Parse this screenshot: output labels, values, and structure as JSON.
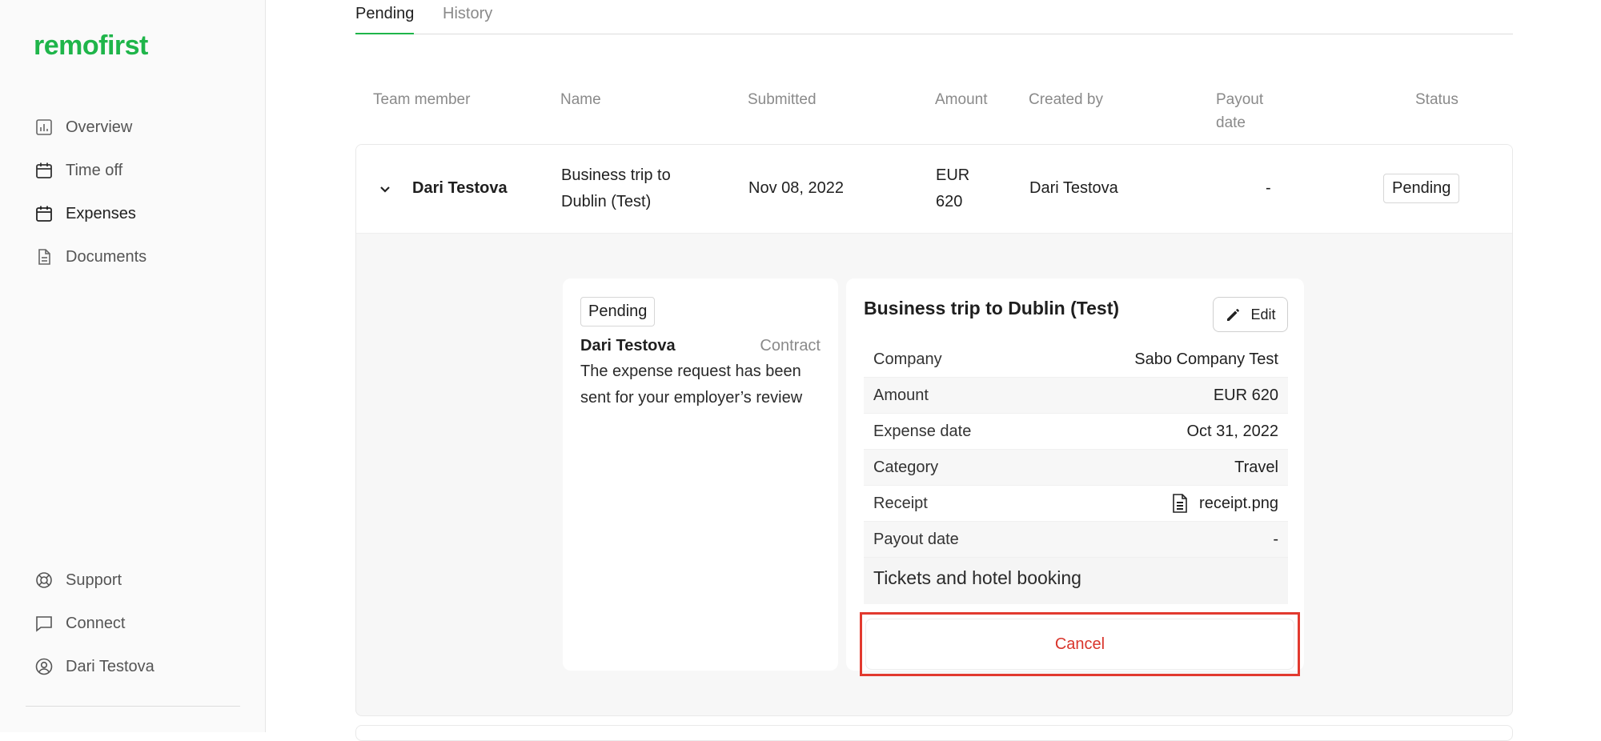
{
  "app": {
    "logo": "remofirst",
    "brand_color": "#1fb54a",
    "danger_color": "#d9342b"
  },
  "sidebar": {
    "items": [
      {
        "label": "Overview",
        "icon": "bar-chart-icon"
      },
      {
        "label": "Time off",
        "icon": "calendar-icon"
      },
      {
        "label": "Expenses",
        "icon": "calendar-icon",
        "active": true
      },
      {
        "label": "Documents",
        "icon": "document-icon"
      }
    ],
    "bottom_items": [
      {
        "label": "Support",
        "icon": "lifebuoy-icon"
      },
      {
        "label": "Connect",
        "icon": "chat-icon"
      },
      {
        "label": "Dari Testova",
        "icon": "user-icon"
      }
    ]
  },
  "tabs": [
    {
      "label": "Pending",
      "active": true
    },
    {
      "label": "History",
      "active": false
    }
  ],
  "table": {
    "headers": [
      "Team member",
      "Name",
      "Submitted",
      "Amount",
      "Created by",
      "Payout date",
      "Status"
    ],
    "headers_payout_line1": "Payout",
    "headers_payout_line2": "date",
    "row": {
      "team_member": "Dari Testova",
      "name_line1": "Business trip to",
      "name_line2": "Dublin (Test)",
      "submitted": "Nov 08, 2022",
      "amount_line1": "EUR",
      "amount_line2": "620",
      "created_by": "Dari Testova",
      "payout_date": "-",
      "status": "Pending"
    }
  },
  "detail": {
    "status_badge": "Pending",
    "author": "Dari Testova",
    "author_role": "Contract",
    "message_line1": "The expense request has been",
    "message_line2": "sent for your employer’s review",
    "title": "Business trip to Dublin (Test)",
    "edit_label": "Edit",
    "fields": [
      {
        "label": "Company",
        "value": "Sabo Company Test"
      },
      {
        "label": "Amount",
        "value": "EUR 620"
      },
      {
        "label": "Expense date",
        "value": "Oct 31, 2022"
      },
      {
        "label": "Category",
        "value": "Travel"
      },
      {
        "label": "Receipt",
        "value": "receipt.png"
      },
      {
        "label": "Payout date",
        "value": "-"
      }
    ],
    "note": "Tickets and hotel booking",
    "cancel_label": "Cancel"
  }
}
